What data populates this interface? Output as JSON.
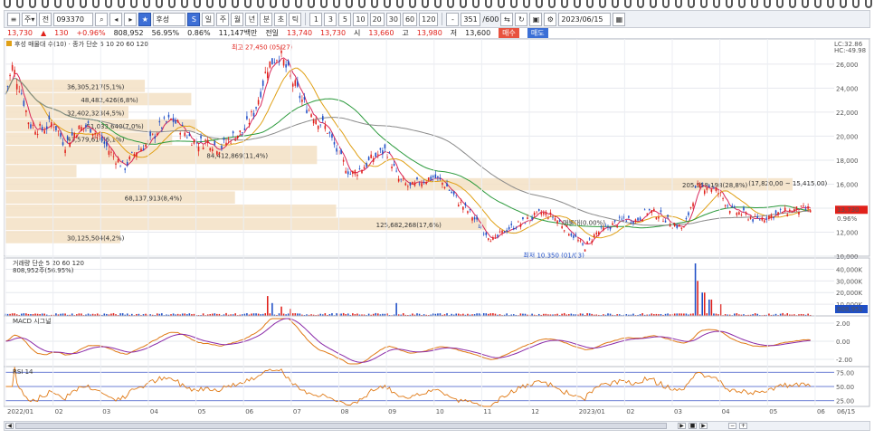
{
  "toolbar": {
    "code": "093370",
    "name": "후성",
    "period_buttons": [
      "일",
      "주",
      "월",
      "년",
      "분",
      "초",
      "틱"
    ],
    "interval_buttons": [
      "1",
      "3",
      "5",
      "10",
      "20",
      "30",
      "60",
      "120"
    ],
    "count_value": "351",
    "count_total": "/600",
    "date": "2023/06/15"
  },
  "info": {
    "price": "13,730",
    "change": "130",
    "change_pct": "+0.96%",
    "volume": "808,952",
    "vol_ratio": "56.95%",
    "turnover_pct": "0.86%",
    "amount": "11,147백만",
    "prev_label": "전일",
    "prev_price": "13,740",
    "bid": "13,730",
    "open_label": "시",
    "open": "13,660",
    "high_label": "고",
    "high": "13,980",
    "low_label": "저",
    "low": "13,600",
    "buy_label": "매수",
    "sell_label": "매도"
  },
  "panes": {
    "price_legend": "후성 매물대 수(10) · 종가 단순 5 10 20 60 120",
    "volume_legend": "거래량 단순 5 20 60 120",
    "volume_sub": "808,952주(56.95%)",
    "macd_legend": "MACD 시그널",
    "rsi_legend": "RSI 14"
  },
  "chart_data": {
    "type": "candlestick",
    "x_range": [
      "2022/01",
      "2023/06"
    ],
    "price_ylim": [
      10000,
      27500
    ],
    "price_ticks": [
      10000,
      12000,
      14000,
      16000,
      18000,
      20000,
      22000,
      24000,
      26000
    ],
    "price_tick_labels": [
      "10,000",
      "12,000",
      "14,000",
      "16,000",
      "18,000",
      "20,000",
      "22,000",
      "24,000",
      "26,000"
    ],
    "last_price_label": "13,730",
    "last_pct_label": "0.96%",
    "hl_labels": [
      "LC:32.86",
      "HC:-49.98"
    ],
    "high_marker": {
      "label": "최고 27,450 (05/27)",
      "price": 27450,
      "month": 5.85
    },
    "low_marker": {
      "label": "최저 10,350 (01/03)",
      "price": 10350,
      "month": 12.05
    },
    "price_path": [
      [
        0,
        23500
      ],
      [
        0.15,
        25800
      ],
      [
        0.35,
        23500
      ],
      [
        0.5,
        21000
      ],
      [
        0.75,
        20500
      ],
      [
        1.0,
        21200
      ],
      [
        1.25,
        19300
      ],
      [
        1.5,
        20500
      ],
      [
        1.75,
        20900
      ],
      [
        2.0,
        19800
      ],
      [
        2.25,
        18400
      ],
      [
        2.5,
        17400
      ],
      [
        2.75,
        18800
      ],
      [
        3.0,
        19400
      ],
      [
        3.25,
        20800
      ],
      [
        3.5,
        21400
      ],
      [
        3.75,
        20400
      ],
      [
        4.0,
        19400
      ],
      [
        4.25,
        19600
      ],
      [
        4.5,
        19000
      ],
      [
        4.75,
        19900
      ],
      [
        5.0,
        20400
      ],
      [
        5.25,
        22300
      ],
      [
        5.5,
        25800
      ],
      [
        5.75,
        26900
      ],
      [
        6.0,
        24800
      ],
      [
        6.25,
        22800
      ],
      [
        6.5,
        21600
      ],
      [
        6.75,
        20600
      ],
      [
        7.0,
        18400
      ],
      [
        7.25,
        16800
      ],
      [
        7.5,
        17400
      ],
      [
        7.75,
        18300
      ],
      [
        8.0,
        18900
      ],
      [
        8.25,
        16400
      ],
      [
        8.5,
        15700
      ],
      [
        8.75,
        16300
      ],
      [
        9.0,
        16600
      ],
      [
        9.25,
        15900
      ],
      [
        9.5,
        14600
      ],
      [
        9.75,
        13600
      ],
      [
        10.0,
        12300
      ],
      [
        10.25,
        11300
      ],
      [
        10.5,
        12200
      ],
      [
        10.75,
        12600
      ],
      [
        11.0,
        13100
      ],
      [
        11.25,
        13600
      ],
      [
        11.5,
        13300
      ],
      [
        11.75,
        12400
      ],
      [
        12.0,
        11400
      ],
      [
        12.15,
        10700
      ],
      [
        12.4,
        11900
      ],
      [
        12.75,
        12600
      ],
      [
        13.0,
        13100
      ],
      [
        13.25,
        13000
      ],
      [
        13.5,
        13800
      ],
      [
        13.75,
        13400
      ],
      [
        14.0,
        12700
      ],
      [
        14.25,
        12300
      ],
      [
        14.5,
        15600
      ],
      [
        14.75,
        15900
      ],
      [
        15.0,
        15200
      ],
      [
        15.25,
        13800
      ],
      [
        15.5,
        13500
      ],
      [
        15.75,
        13000
      ],
      [
        16.0,
        13300
      ],
      [
        16.25,
        13600
      ],
      [
        16.5,
        13800
      ],
      [
        16.75,
        13900
      ]
    ],
    "ma_series": [
      {
        "name": "5",
        "color": "#d8265a",
        "smooth": 3
      },
      {
        "name": "20",
        "color": "#e0a016",
        "smooth": 14
      },
      {
        "name": "60",
        "color": "#2b9a3c",
        "smooth": 40
      },
      {
        "name": "120",
        "color": "#8a8a8a",
        "smooth": 80
      }
    ],
    "volume_profile": [
      {
        "label": "30,125,504(4,2%)",
        "low": 11000,
        "high": 12100,
        "pct": 4.2
      },
      {
        "label": "125,682,268(17,6%)",
        "low": 12100,
        "high": 13200,
        "pct": 17.6
      },
      {
        "label": "",
        "low": 13200,
        "high": 14300,
        "pct": 12.1
      },
      {
        "label": "68,137,913(8,4%)",
        "low": 14300,
        "high": 15400,
        "pct": 8.4
      },
      {
        "label": "205,558,198(28,8%)",
        "low": 15400,
        "high": 16500,
        "pct": 28.8
      },
      {
        "label": "",
        "low": 16500,
        "high": 17600,
        "pct": 2.6
      },
      {
        "label": "84,412,869(11,4%)",
        "low": 17600,
        "high": 19200,
        "pct": 11.4
      },
      {
        "label": "43,579,616(6,1%)",
        "low": 19200,
        "high": 20300,
        "pct": 6.1
      },
      {
        "label": "51,033,640(7,0%)",
        "low": 20300,
        "high": 21400,
        "pct": 7.0
      },
      {
        "label": "32,402,323(4,5%)",
        "low": 21400,
        "high": 22500,
        "pct": 4.5
      },
      {
        "label": "48,482,426(6,8%)",
        "low": 22500,
        "high": 23600,
        "pct": 6.8
      },
      {
        "label": "36,305,217(5,1%)",
        "low": 23600,
        "high": 24700,
        "pct": 5.1
      }
    ],
    "profile_annotations": [
      {
        "label": "(17,820,00 ~ 15,415,00)",
        "price": 15900,
        "month": 15.6
      },
      {
        "label": "매물대(0.00%)",
        "price": 12600,
        "month": 11.7
      }
    ],
    "volume_ylim": [
      0,
      45000
    ],
    "volume_ticks": [
      "10,000K",
      "20,000K",
      "30,000K",
      "40,000K"
    ],
    "volume_tick_values": [
      10000,
      20000,
      30000,
      40000
    ],
    "volume_spikes": [
      [
        5.5,
        17000
      ],
      [
        5.6,
        11000
      ],
      [
        5.8,
        8000
      ],
      [
        6.0,
        6000
      ],
      [
        8.2,
        11000
      ],
      [
        14.5,
        45000
      ],
      [
        14.55,
        30000
      ],
      [
        14.65,
        20000
      ],
      [
        14.8,
        14000
      ],
      [
        15.0,
        10000
      ]
    ],
    "volume_last_label": "808,952",
    "macd_ylim": [
      -2.5,
      2.5
    ],
    "macd_ticks": [
      "2.00",
      "0.00",
      "-2.00"
    ],
    "macd_tick_values": [
      2,
      0,
      -2
    ],
    "rsi_ylim": [
      15,
      85
    ],
    "rsi_ticks": [
      "75.00",
      "50.00",
      "25.00"
    ],
    "rsi_tick_values": [
      75,
      50,
      25
    ],
    "month_labels": [
      "2022/01",
      "02",
      "03",
      "04",
      "05",
      "06",
      "07",
      "08",
      "09",
      "10",
      "11",
      "12",
      "2023/01",
      "02",
      "03",
      "04",
      "05",
      "06"
    ],
    "last_axis_label": "06/15"
  },
  "scrollbar": {
    "left_arrow": "◀",
    "right_arrow": "▶"
  }
}
